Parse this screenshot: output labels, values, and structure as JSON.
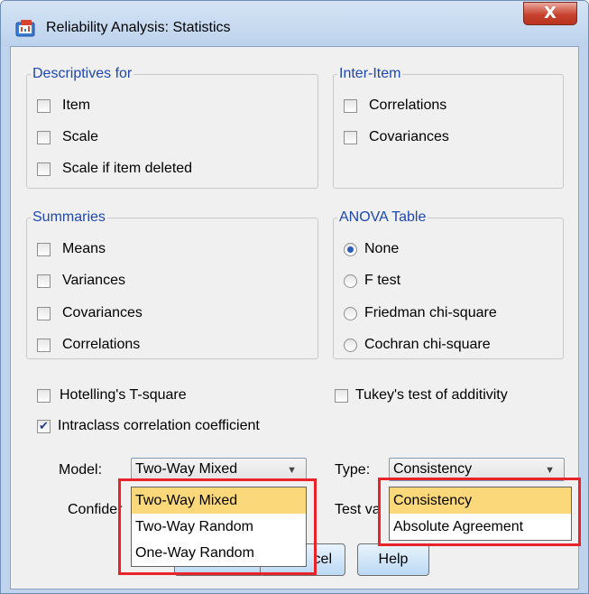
{
  "window": {
    "title": "Reliability Analysis: Statistics",
    "close_label": "X"
  },
  "descriptives": {
    "legend": "Descriptives for",
    "items": [
      "Item",
      "Scale",
      "Scale if item deleted"
    ]
  },
  "inter_item": {
    "legend": "Inter-Item",
    "items": [
      "Correlations",
      "Covariances"
    ]
  },
  "summaries": {
    "legend": "Summaries",
    "items": [
      "Means",
      "Variances",
      "Covariances",
      "Correlations"
    ]
  },
  "anova": {
    "legend": "ANOVA Table",
    "options": [
      "None",
      "F test",
      "Friedman chi-square",
      "Cochran chi-square"
    ],
    "selected": "None"
  },
  "options": {
    "hotelling": "Hotelling's T-square",
    "tukey": "Tukey's test of additivity",
    "icc": "Intraclass correlation coefficient",
    "icc_checked": true
  },
  "model": {
    "label": "Model:",
    "value": "Two-Way Mixed",
    "options": [
      "Two-Way Mixed",
      "Two-Way Random",
      "One-Way Random"
    ]
  },
  "type": {
    "label": "Type:",
    "value": "Consistency",
    "options": [
      "Consistency",
      "Absolute Agreement"
    ]
  },
  "partial": {
    "confidence": "Confider",
    "test_value": "Test va",
    "cancel": "cel"
  },
  "buttons": {
    "help": "Help"
  },
  "colors": {
    "legend_text": "#1f47b0",
    "highlight": "#fbd97a",
    "annotation_box": "#e8232a",
    "close_button": "#c8432f"
  }
}
